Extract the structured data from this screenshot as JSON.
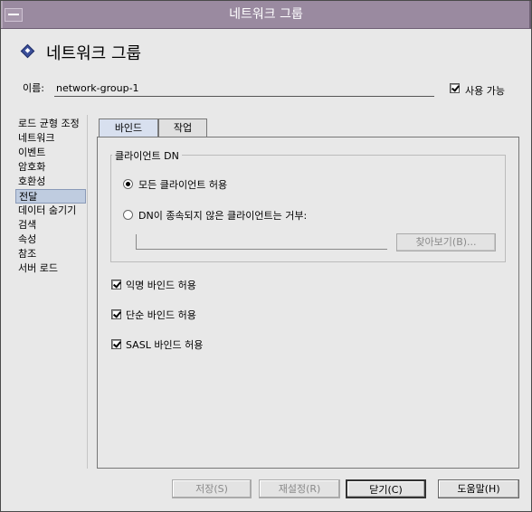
{
  "window": {
    "title": "네트워크 그룹"
  },
  "header": {
    "title": "네트워크 그룹",
    "icon": "diamond-icon"
  },
  "name": {
    "label": "이름:",
    "value": "network-group-1"
  },
  "enable": {
    "label": "사용 가능",
    "checked": true
  },
  "nav": {
    "selected": "전달",
    "items": [
      "로드 균형 조정",
      "네트워크",
      "이벤트",
      "암호화",
      "호환성",
      "전달",
      "데이터 숨기기",
      "검색",
      "속성",
      "참조",
      "서버 로드"
    ]
  },
  "tabs": [
    {
      "label": "바인드",
      "active": true
    },
    {
      "label": "작업",
      "active": false
    }
  ],
  "bind": {
    "client_dn_group": "클라이언트 DN",
    "radio_all": "모든 클라이언트 허용",
    "radio_deny": "DN이 종속되지 않은 클라이언트는 거부:",
    "dn_value": "",
    "browse_button": "찾아보기(B)...",
    "anonymous": {
      "label": "익명 바인드 허용",
      "checked": true
    },
    "simple": {
      "label": "단순 바인드 허용",
      "checked": true
    },
    "sasl": {
      "label": "SASL 바인드 허용",
      "checked": true
    }
  },
  "buttons": {
    "save": "저장(S)",
    "reset": "재설정(R)",
    "close": "닫기(C)",
    "help": "도움말(H)"
  },
  "colors": {
    "titlebar": "#9a8aa0",
    "selection": "#bfcce0",
    "active_tab": "#d8e0ef",
    "header_icon": "#3b4f9a"
  }
}
